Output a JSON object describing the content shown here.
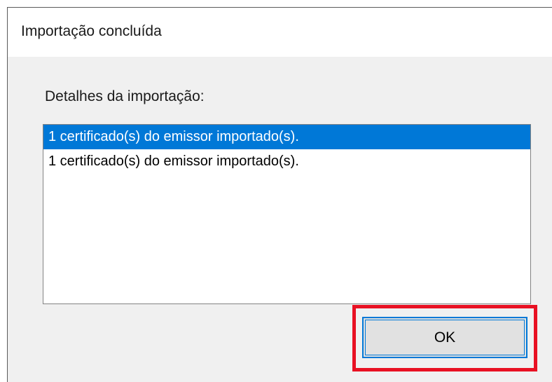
{
  "dialog": {
    "title": "Importação concluída",
    "details_label": "Detalhes da importação:",
    "list_items": [
      {
        "text": "1 certificado(s) do emissor importado(s).",
        "selected": true
      },
      {
        "text": "1 certificado(s) do emissor importado(s).",
        "selected": false
      }
    ],
    "ok_label": "OK"
  },
  "colors": {
    "selection": "#0078d7",
    "highlight": "#e81123",
    "dialog_bg": "#f0f0f0",
    "button_bg": "#e1e1e1"
  }
}
